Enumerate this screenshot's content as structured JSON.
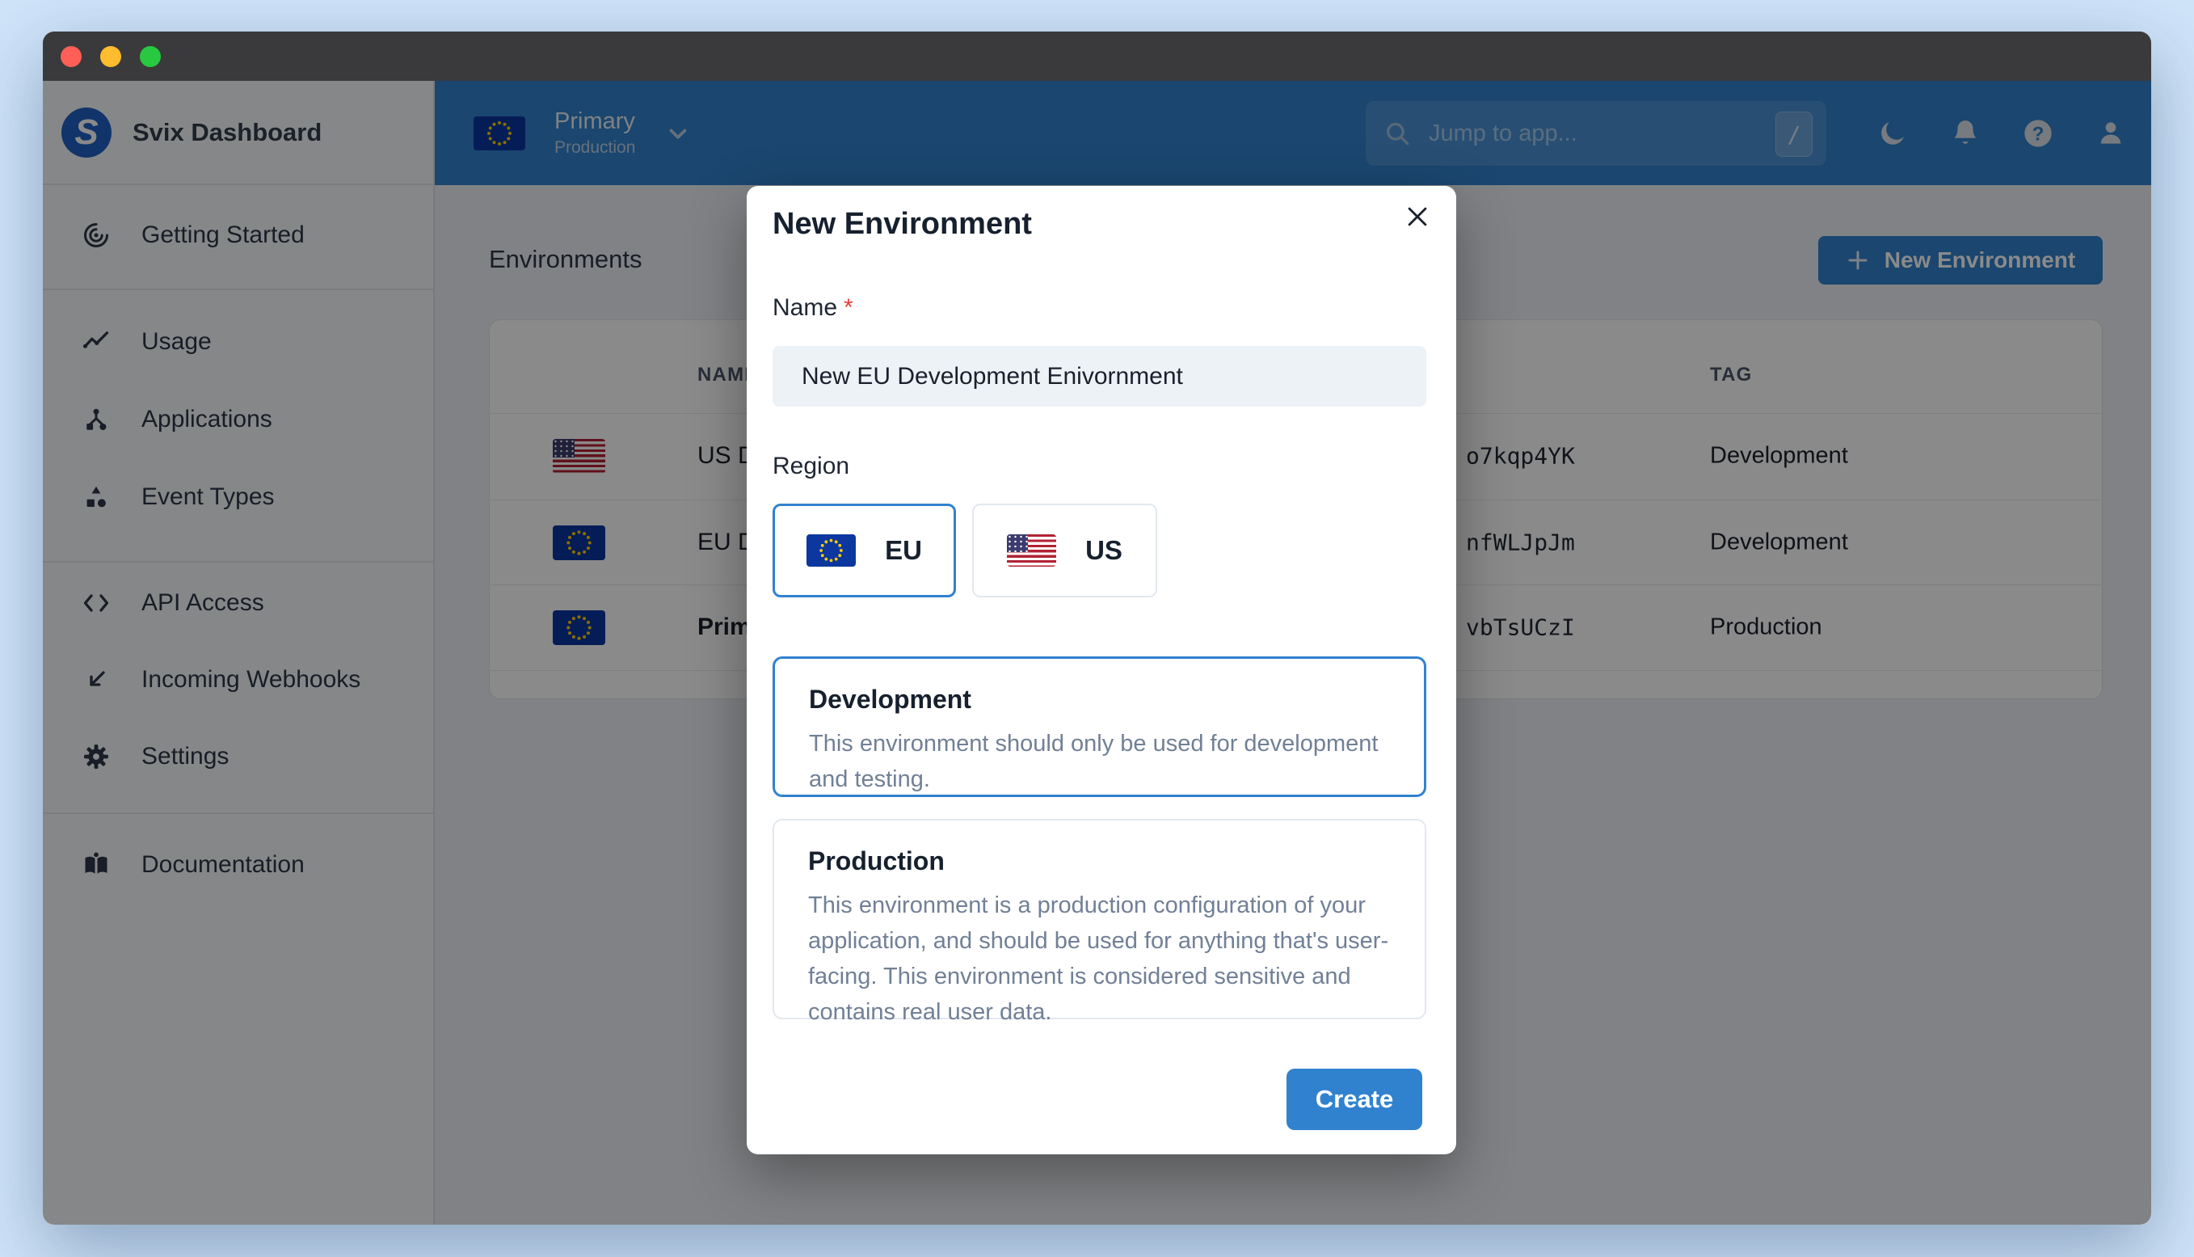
{
  "sidebar": {
    "brand": "Svix Dashboard",
    "logo_letter": "S",
    "items": [
      {
        "label": "Getting Started",
        "icon": "target-icon"
      },
      {
        "label": "Usage",
        "icon": "trend-icon"
      },
      {
        "label": "Applications",
        "icon": "nodes-icon"
      },
      {
        "label": "Event Types",
        "icon": "shapes-icon"
      },
      {
        "label": "API Access",
        "icon": "code-icon"
      },
      {
        "label": "Incoming Webhooks",
        "icon": "arrow-down-left-icon"
      },
      {
        "label": "Settings",
        "icon": "gear-icon"
      },
      {
        "label": "Documentation",
        "icon": "book-icon"
      }
    ]
  },
  "topbar": {
    "environment": {
      "name": "Primary",
      "tag": "Production"
    },
    "search": {
      "placeholder": "Jump to app...",
      "shortcut": "/"
    }
  },
  "page": {
    "title": "Environments",
    "new_environment_button": "New Environment"
  },
  "table": {
    "headers": {
      "name": "NAME",
      "tag": "TAG"
    },
    "rows": [
      {
        "flag": "us",
        "name": "US D",
        "id": "o7kqp4YK",
        "tag": "Development"
      },
      {
        "flag": "eu",
        "name": "EU D",
        "id": "nfWLJpJm",
        "tag": "Development"
      },
      {
        "flag": "eu",
        "name": "Prim",
        "id": "vbTsUCzI",
        "tag": "Production"
      }
    ]
  },
  "modal": {
    "title": "New Environment",
    "name_label": "Name",
    "required_marker": "*",
    "name_value": "New EU Development Enivornment",
    "region_label": "Region",
    "regions": [
      {
        "label": "EU",
        "flag": "eu",
        "selected": true
      },
      {
        "label": "US",
        "flag": "us",
        "selected": false
      }
    ],
    "types": [
      {
        "title": "Development",
        "description": "This environment should only be used for development and testing.",
        "selected": true
      },
      {
        "title": "Production",
        "description": "This environment is a production configuration of your application, and should be used for anything that's user-facing. This environment is considered sensitive and contains real user data.",
        "selected": false
      }
    ],
    "create_button": "Create"
  },
  "colors": {
    "accent": "#3182ce",
    "selected_border": "#3182ce",
    "required": "#e53e3e",
    "eu_flag_blue": "#0b379f",
    "us_flag_red": "#b22234",
    "us_flag_blue": "#3c3b6e"
  }
}
